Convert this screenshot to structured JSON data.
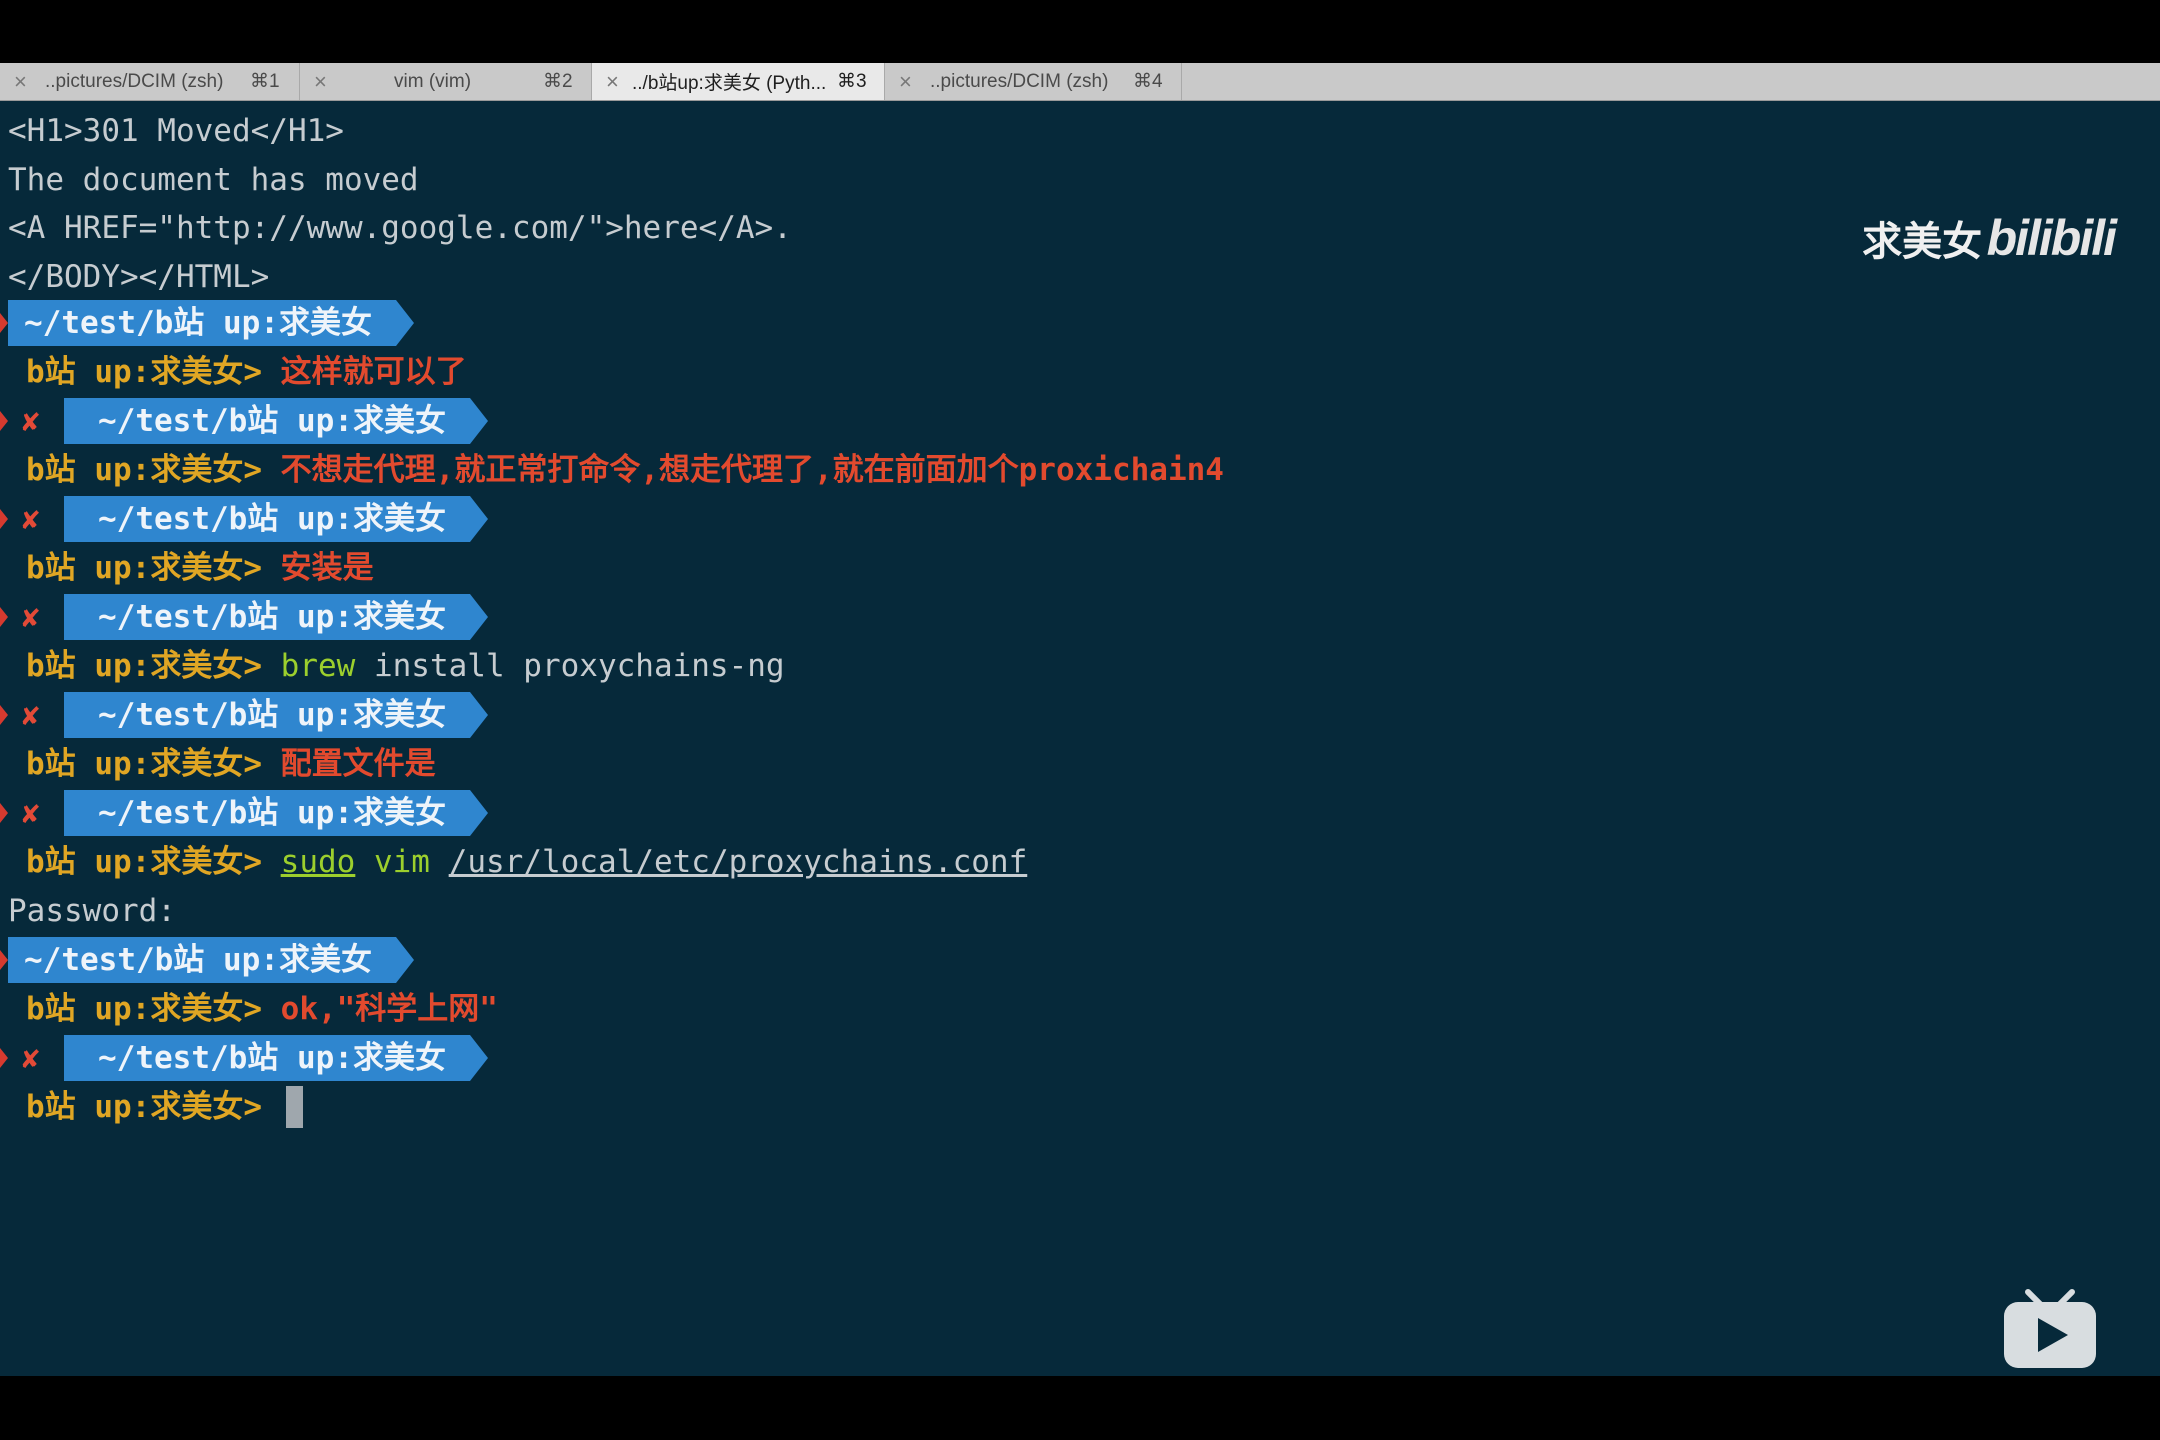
{
  "tabs": [
    {
      "title": "..pictures/DCIM (zsh)",
      "shortcut": "⌘1",
      "active": false
    },
    {
      "title": "vim (vim)",
      "shortcut": "⌘2",
      "active": false
    },
    {
      "title": "../b站up:求美女 (Pyth...",
      "shortcut": "⌘3",
      "active": true
    },
    {
      "title": "..pictures/DCIM (zsh)",
      "shortcut": "⌘4",
      "active": false
    }
  ],
  "watermark": {
    "text": "求美女",
    "logo": "bilibili"
  },
  "terminal": {
    "html_lines": [
      "<H1>301 Moved</H1>",
      "The document has moved",
      "<A HREF=\"http://www.google.com/\">here</A>.",
      "</BODY></HTML>"
    ],
    "path_segment": "~/test/b站 up:求美女",
    "prompt": "b站 up:求美女>",
    "error_mark": "✘",
    "msg1": "这样就可以了",
    "msg2": "不想走代理,就正常打命令,想走代理了,就在前面加个proxichain4",
    "msg3": "安装是",
    "cmd_brew": "brew",
    "cmd_brew_args": "install proxychains-ng",
    "msg4": "配置文件是",
    "cmd_sudo": "sudo",
    "cmd_vim": "vim",
    "cmd_path": "/usr/local/etc/proxychains.conf",
    "password_label": "Password:",
    "msg5": "ok,\"科学上网\""
  },
  "colors": {
    "terminal_bg": "#06293a",
    "segment_bg": "#2f86cf",
    "prompt": "#e0a624",
    "message": "#e24a2e",
    "command": "#9ccf2d"
  }
}
